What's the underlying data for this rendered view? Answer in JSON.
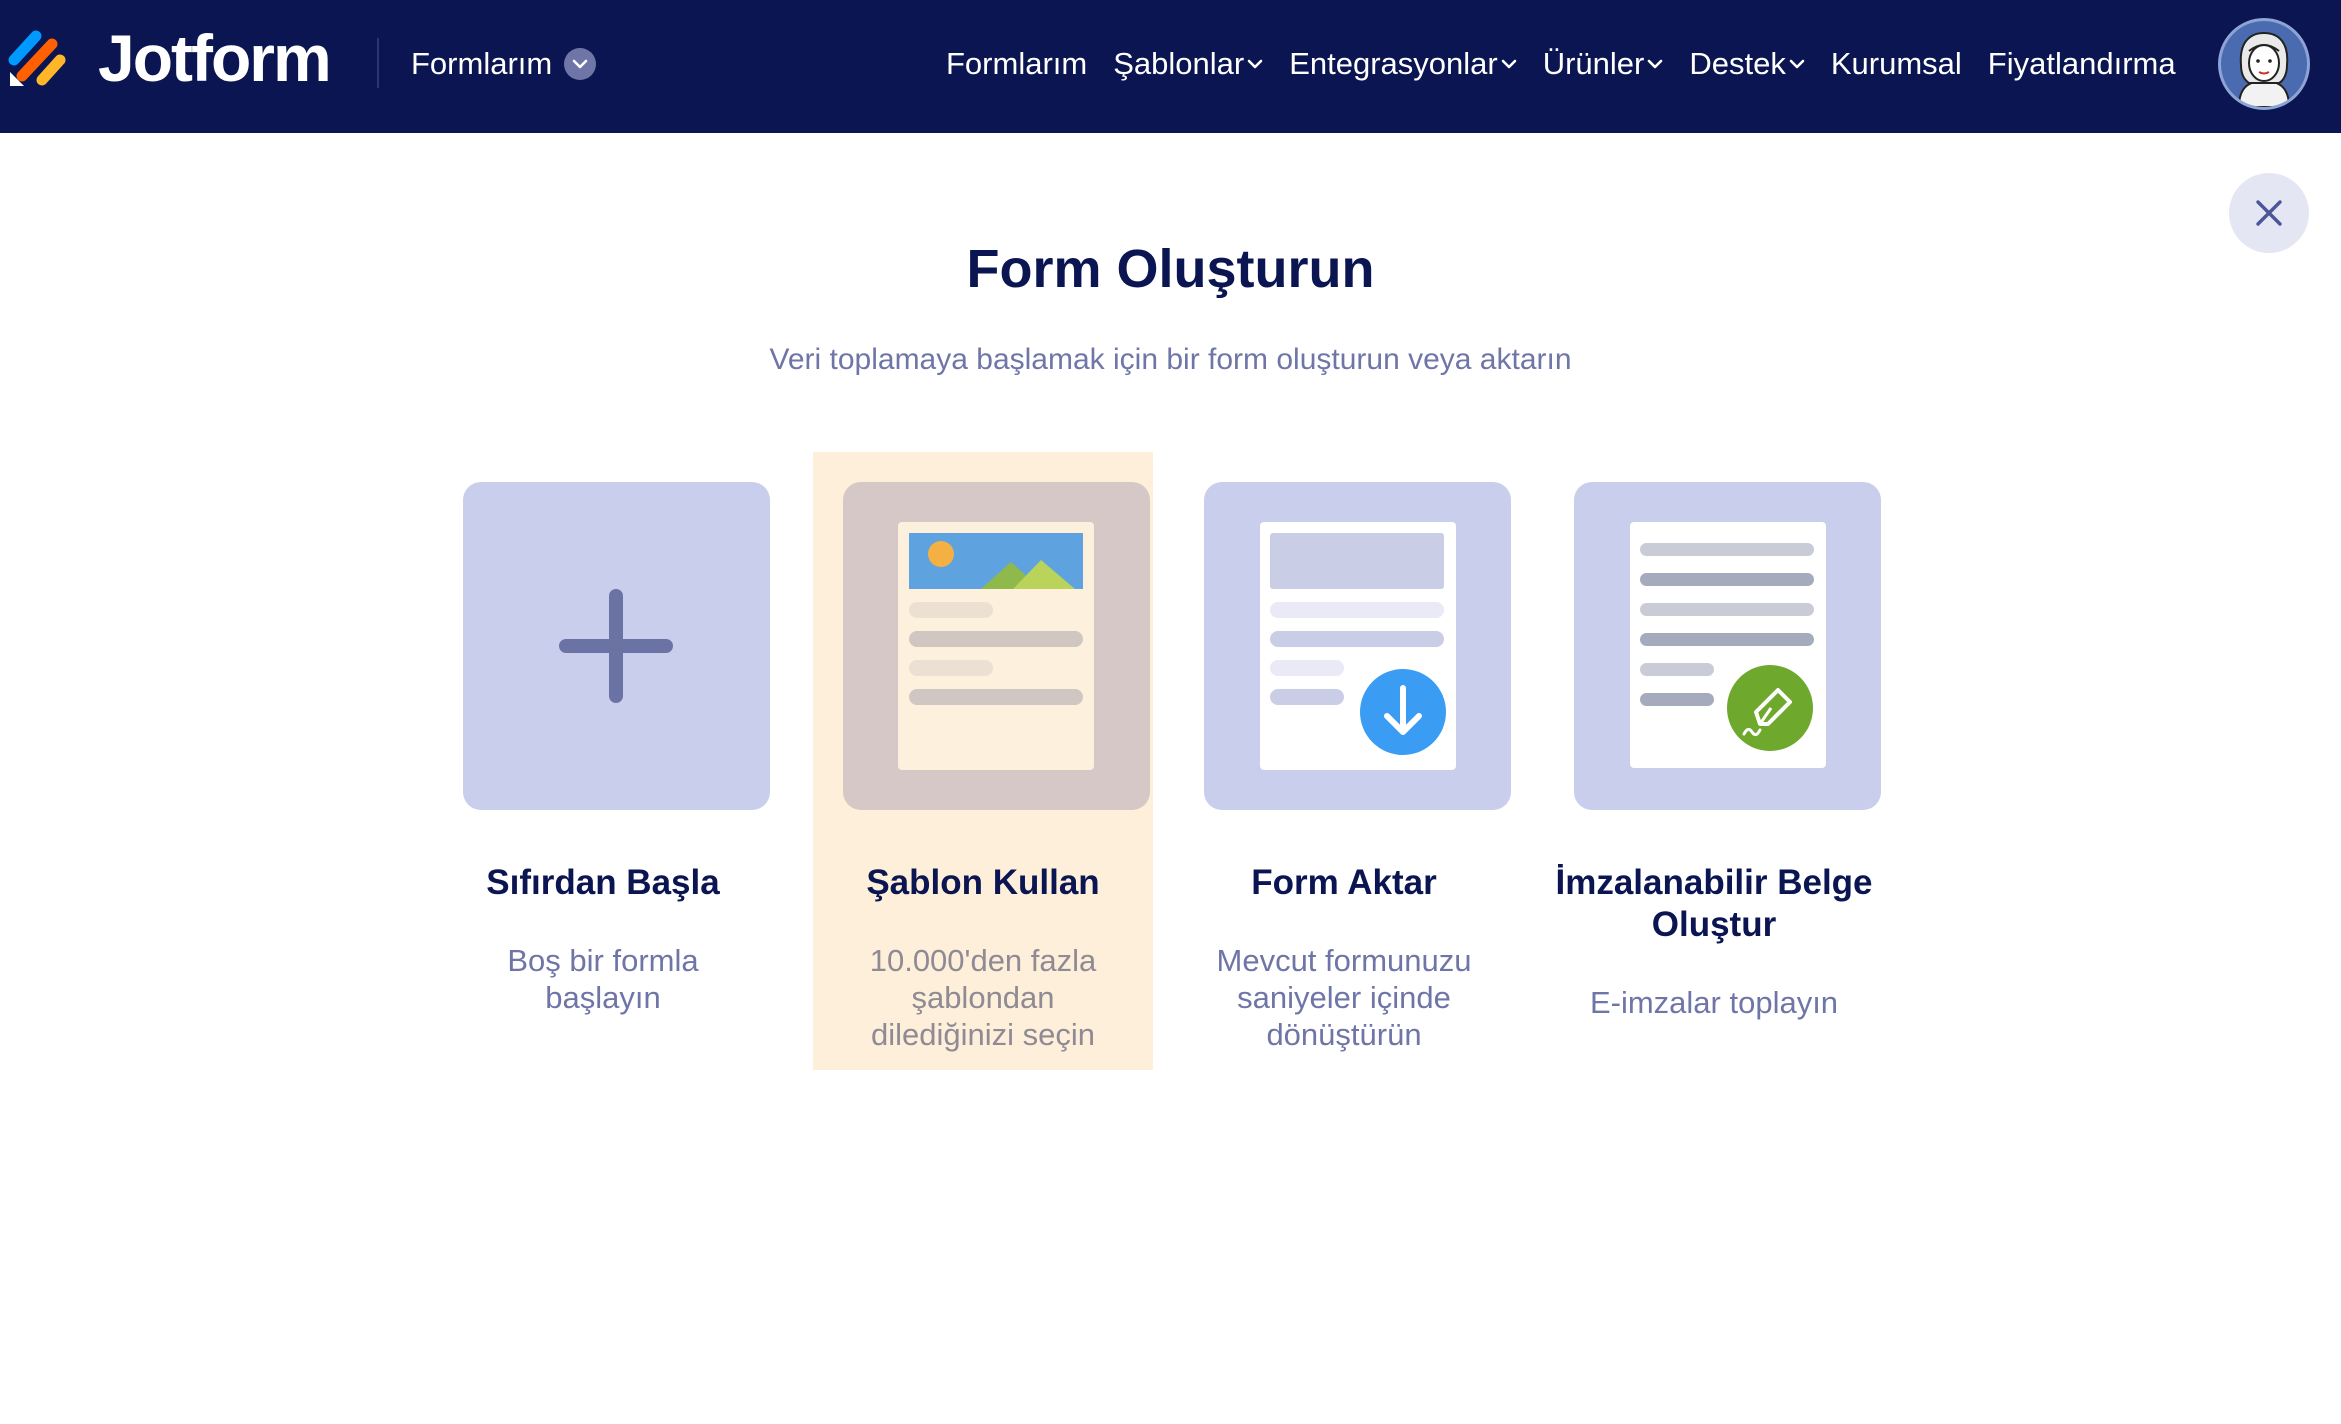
{
  "header": {
    "brand": "Jotform",
    "myforms_dropdown": "Formlarım",
    "nav": [
      {
        "label": "Formlarım",
        "has_chevron": false
      },
      {
        "label": "Şablonlar",
        "has_chevron": true
      },
      {
        "label": "Entegrasyonlar",
        "has_chevron": true
      },
      {
        "label": "Ürünler",
        "has_chevron": true
      },
      {
        "label": "Destek",
        "has_chevron": true
      },
      {
        "label": "Kurumsal",
        "has_chevron": false
      },
      {
        "label": "Fiyatlandırma",
        "has_chevron": false
      }
    ],
    "avatar_icon": "user-avatar"
  },
  "modal": {
    "title": "Form Oluşturun",
    "subtitle": "Veri toplamaya başlamak için bir form oluşturun veya aktarın",
    "close_icon": "close-icon",
    "options": [
      {
        "title": "Sıfırdan Başla",
        "description": "Boş bir formla başlayın",
        "icon": "plus-icon",
        "highlighted": false
      },
      {
        "title": "Şablon Kullan",
        "description": "10.000'den fazla şablondan dilediğinizi seçin",
        "icon": "template-icon",
        "highlighted": true
      },
      {
        "title": "Form Aktar",
        "description": "Mevcut formunuzu saniyeler içinde dönüştürün",
        "icon": "import-form-icon",
        "highlighted": false
      },
      {
        "title": "İmzalanabilir Belge Oluştur",
        "description": "E-imzalar toplayın",
        "icon": "sign-document-icon",
        "highlighted": false
      }
    ]
  },
  "colors": {
    "header_bg": "#0a1551",
    "text_dark": "#0a1551",
    "text_muted": "#6f76a7",
    "tile_bg": "#c9ceec",
    "highlight_bg": "#fdefd9",
    "import_blue": "#3a9cf2",
    "sign_green": "#6ea82c"
  }
}
